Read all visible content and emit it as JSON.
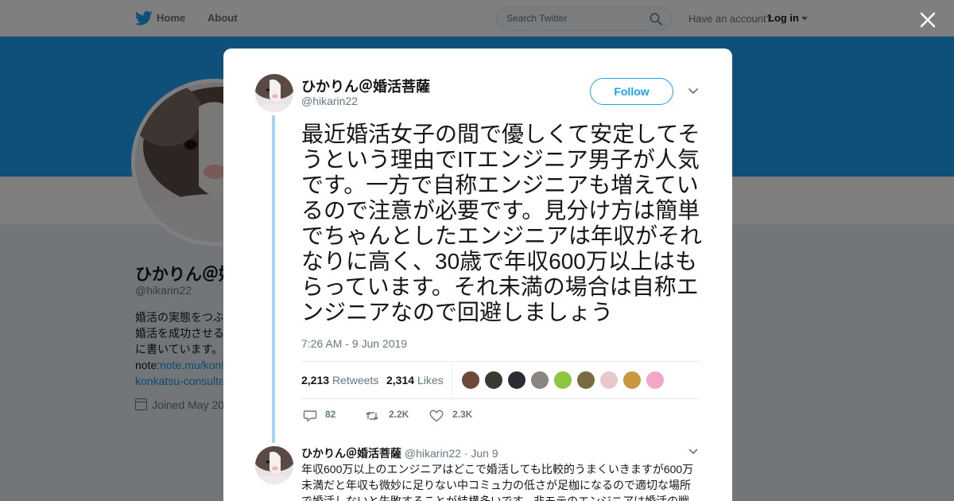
{
  "nav": {
    "home": "Home",
    "about": "About",
    "search_placeholder": "Search Twitter",
    "account_prompt": "Have an account?",
    "login": "Log in"
  },
  "profile": {
    "name": "ひかりん＠婚",
    "handle": "@hikarin22",
    "bio_line1": "婚活の実態をつぶ",
    "bio_line2": "婚活を成功させる",
    "bio_line3": "に書いています。",
    "bio_line4_prefix": "note:",
    "bio_line4_link": "note.mu/konk",
    "bio_line5_link": "konkatsu-consulta",
    "joined": "Joined May 20"
  },
  "tweet": {
    "name": "ひかりん＠婚活菩薩",
    "handle": "@hikarin22",
    "follow": "Follow",
    "text": "最近婚活女子の間で優しくて安定してそうという理由でITエンジニア男子が人気です。一方で自称エンジニアも増えているので注意が必要です。見分け方は簡単でちゃんとしたエンジニアは年収がそれなりに高く、30歳で年収600万以上はもらっています。それ未満の場合は自称エンジニアなので回避しましょう",
    "time": "7:26 AM - 9 Jun 2019",
    "retweets_count": "2,213",
    "retweets_label": "Retweets",
    "likes_count": "2,314",
    "likes_label": "Likes",
    "replies_action": "82",
    "retweets_action": "2.2K",
    "likes_action": "2.3K",
    "liker_colors": [
      "#6b4a3a",
      "#3a3a32",
      "#2e2a33",
      "#8a8580",
      "#8dc63f",
      "#7a6a40",
      "#e8c8c8",
      "#c89a40",
      "#f4a6c8"
    ]
  },
  "reply": {
    "name": "ひかりん＠婚活菩薩",
    "handle": "@hikarin22",
    "date": "· Jun 9",
    "text": "年収600万以上のエンジニアはどこで婚活しても比較的うまくいきますが600万未満だと年収も微妙に足りない中コミュ力の低さが足枷になるので適切な場所で婚活しないと失敗することが結構多いです。非モテのエンジニアは婚活の戦"
  },
  "colors": {
    "accent": "#1da1f2",
    "link": "#1b95e0",
    "muted": "#657786"
  }
}
